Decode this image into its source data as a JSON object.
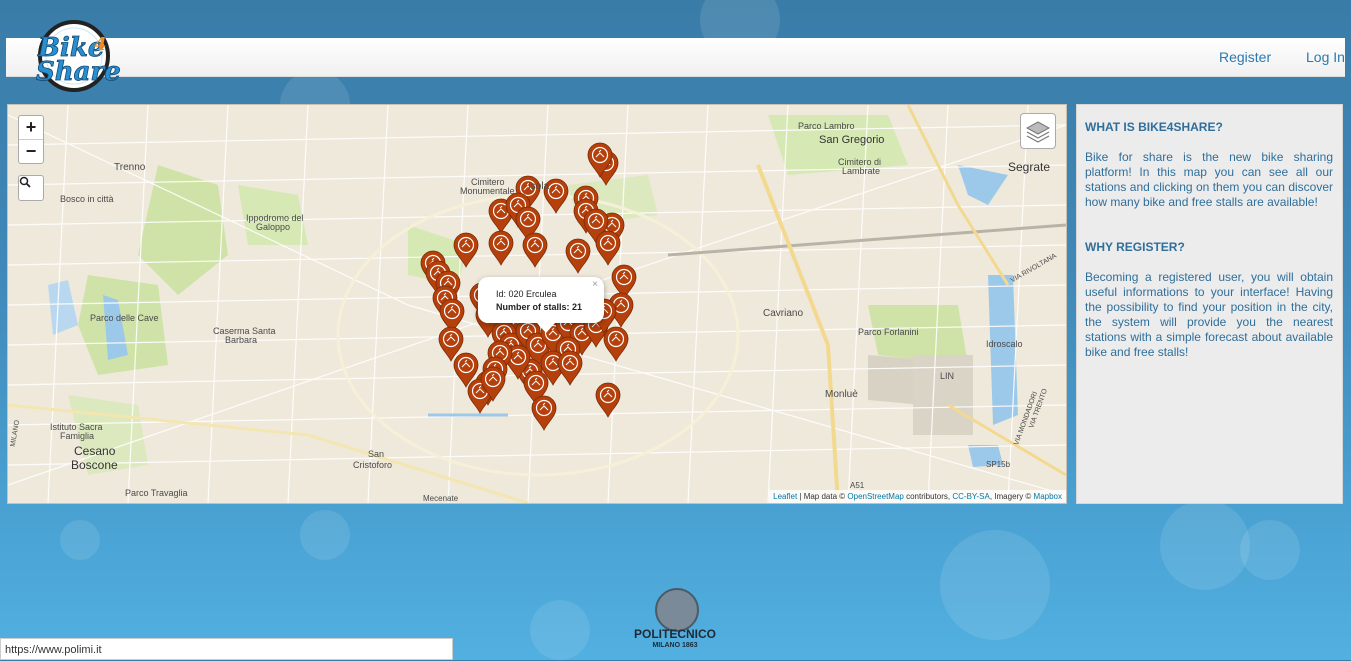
{
  "header": {
    "logo_text_top": "Bike",
    "logo_text_num": "4",
    "logo_text_bottom": "Share",
    "register_label": "Register",
    "login_label": "Log In"
  },
  "map": {
    "zoom_in": "+",
    "zoom_out": "−",
    "search_icon": "search-icon",
    "layers_icon": "layers-icon",
    "places": {
      "trenno": "Trenno",
      "bosco": "Bosco in città",
      "ippodromo1": "Ippodromo del",
      "ippodromo2": "Galoppo",
      "cimitero1": "Cimitero",
      "cimitero2": "Monumentale",
      "isola": "Isola",
      "parco_cave": "Parco delle Cave",
      "caserma1": "Caserma Santa",
      "caserma2": "Barbara",
      "istituto1": "Istituto Sacra",
      "istituto2": "Famiglia",
      "cesano": "Cesano",
      "boscone": "Boscone",
      "parco_travaglia": "Parco Travaglia",
      "san_cristoforo1": "San",
      "san_cristoforo2": "Cristoforo",
      "parco_lambro": "Parco Lambro",
      "san_gregorio": "San Gregorio",
      "cimitero_lambrate1": "Cimitero di",
      "cimitero_lambrate2": "Lambrate",
      "segrate": "Segrate",
      "cavriano": "Cavriano",
      "parco_forlanini": "Parco Forlanini",
      "idroscalo": "Idroscalo",
      "lin": "LIN",
      "monlue": "Monluè",
      "a51": "A51",
      "sp15b": "SP15b",
      "via_rivoltana": "VIA RIVOLTANA",
      "via_mondadori": "VIA MONDADORI",
      "via_trento": "VIA TRENTO",
      "milano": "MILANO",
      "mecenate": "Mecenate"
    },
    "popup": {
      "id_line": "Id: 020 Erculea",
      "stalls_line": "Number of stalls: 21",
      "close": "×"
    },
    "attribution": {
      "leaflet": "Leaflet",
      "map_data": " | Map data © ",
      "osm": "OpenStreetMap",
      "contributors": " contributors, ",
      "license": "CC-BY-SA",
      "imagery": ", Imagery © ",
      "mapbox": "Mapbox"
    },
    "marker_color": "#b5400c"
  },
  "info": {
    "what_title": "WHAT IS BIKE4SHARE?",
    "what_text": "Bike for share is the new bike sharing platform! In this map you can see all our stations and clicking on them you can discover how many bike and free stalls are available!",
    "why_title": "WHY REGISTER?",
    "why_text": "Becoming a registered user, you will obtain useful informations to your interface! Having the possibility to find your position in the city, the system will provide you the nearest stations with a simple forecast about available bike and free stalls!"
  },
  "footer": {
    "polimi_name": "POLITECNICO",
    "polimi_sub": "MILANO 1863"
  },
  "statusbar": {
    "url": "https://www.polimi.it"
  }
}
